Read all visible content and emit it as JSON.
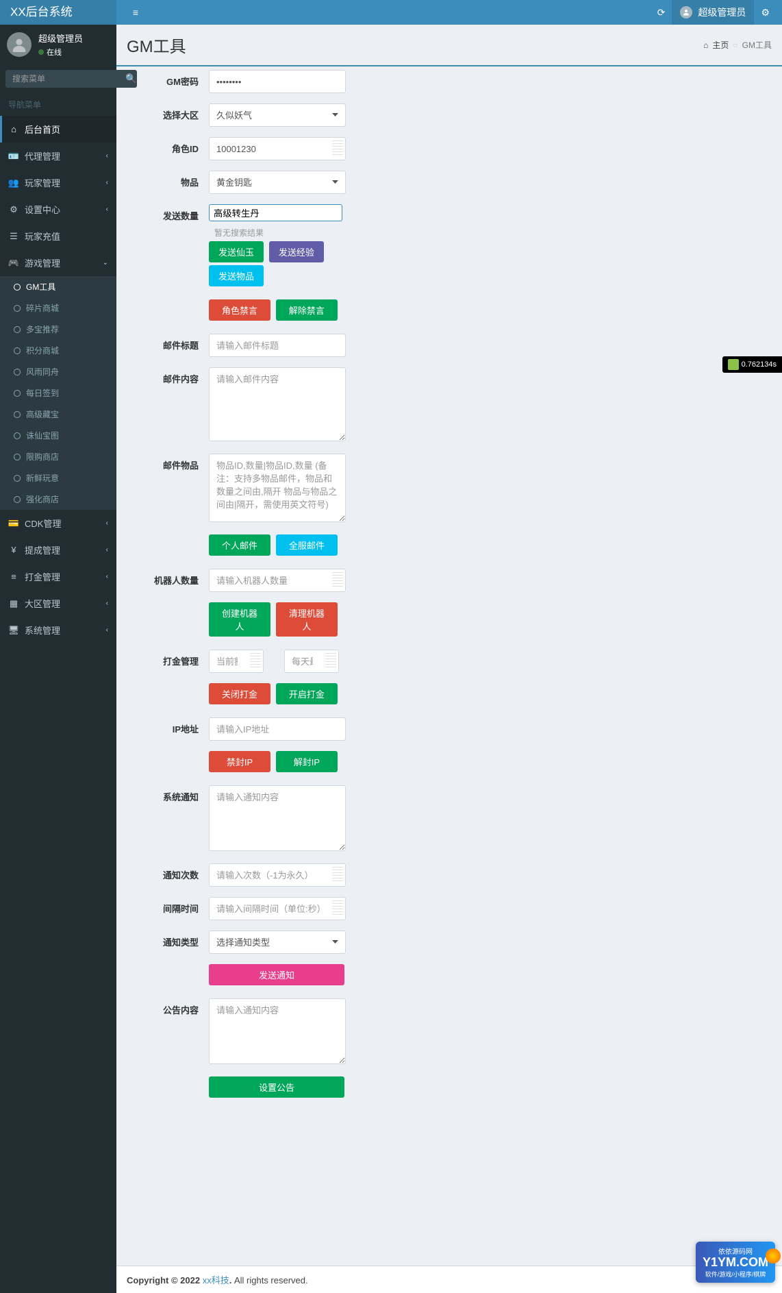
{
  "header": {
    "logo": "XX后台系统",
    "username": "超级管理员"
  },
  "sidebar": {
    "username": "超级管理员",
    "statusText": "在线",
    "searchPlaceholder": "搜索菜单",
    "navHeader": "导航菜单",
    "items": [
      {
        "label": "后台首页",
        "icon": "home",
        "active": true
      },
      {
        "label": "代理管理",
        "icon": "id",
        "expand": true
      },
      {
        "label": "玩家管理",
        "icon": "users",
        "expand": true
      },
      {
        "label": "设置中心",
        "icon": "cogs",
        "expand": true
      },
      {
        "label": "玩家充值",
        "icon": "list"
      },
      {
        "label": "游戏管理",
        "icon": "gamepad",
        "expand": true,
        "open": true,
        "sub": [
          {
            "label": "GM工具",
            "active": true
          },
          {
            "label": "碎片商城"
          },
          {
            "label": "多宝推荐"
          },
          {
            "label": "积分商城"
          },
          {
            "label": "风雨同舟"
          },
          {
            "label": "每日签到"
          },
          {
            "label": "高级藏宝"
          },
          {
            "label": "诛仙宝图"
          },
          {
            "label": "限购商店"
          },
          {
            "label": "新鲜玩意"
          },
          {
            "label": "强化商店"
          }
        ]
      },
      {
        "label": "CDK管理",
        "icon": "card",
        "expand": true
      },
      {
        "label": "提成管理",
        "icon": "yen",
        "expand": true
      },
      {
        "label": "打金管理",
        "icon": "list2",
        "expand": true
      },
      {
        "label": "大区管理",
        "icon": "grid",
        "expand": true
      },
      {
        "label": "系统管理",
        "icon": "desktop",
        "expand": true
      }
    ]
  },
  "page": {
    "title": "GM工具",
    "breadcrumb": {
      "home": "主页",
      "current": "GM工具"
    }
  },
  "form": {
    "gmPasswordLabel": "GM密码",
    "gmPasswordValue": "••••••••",
    "regionLabel": "选择大区",
    "regionValue": "久似妖气",
    "roleIdLabel": "角色ID",
    "roleIdValue": "10001230",
    "itemLabel": "物品",
    "itemValue": "黄金钥匙",
    "qtyLabel": "发送数量",
    "dropdownInput": "高级转生丹",
    "dropdownEmpty": "暂无搜索结果",
    "btnSendXianyu": "发送仙玉",
    "btnSendExp": "发送经验",
    "btnSendItem": "发送物品",
    "btnBanRole": "角色禁言",
    "btnUnban": "解除禁言",
    "mailTitleLabel": "邮件标题",
    "mailTitlePh": "请输入邮件标题",
    "mailContentLabel": "邮件内容",
    "mailContentPh": "请输入邮件内容",
    "mailItemLabel": "邮件物品",
    "mailItemPh": "物品ID,数量|物品ID,数量 (备注：支持多物品邮件，物品和数量之间由,隔开 物品与物品之间由|隔开，需使用英文符号)",
    "btnPersonalMail": "个人邮件",
    "btnServerMail": "全服邮件",
    "robotLabel": "机器人数量",
    "robotPh": "请输入机器人数量",
    "btnCreateRobot": "创建机器人",
    "btnClearRobot": "清理机器人",
    "goldLabel": "打金管理",
    "goldPh1": "当前额度",
    "goldPh2": "每天最大额",
    "btnCloseGold": "关闭打金",
    "btnOpenGold": "开启打金",
    "ipLabel": "IP地址",
    "ipPh": "请输入IP地址",
    "btnBanIp": "禁封IP",
    "btnUnbanIp": "解封IP",
    "noticeLabel": "系统通知",
    "noticePh": "请输入通知内容",
    "noticeCountLabel": "通知次数",
    "noticeCountPh": "请输入次数（-1为永久）",
    "intervalLabel": "间隔时间",
    "intervalPh": "请输入间隔时间（单位:秒）",
    "noticeTypeLabel": "通知类型",
    "noticeTypeValue": "选择通知类型",
    "btnSendNotice": "发送通知",
    "announceLabel": "公告内容",
    "announcePh": "请输入通知内容",
    "btnSetAnnounce": "设置公告"
  },
  "footer": {
    "copyright": "Copyright © 2022 ",
    "company": "xx科技",
    "rights": " All rights reserved."
  },
  "trace": "0.762134s",
  "watermark": {
    "top": "依依源码网",
    "mid": "Y1YM.COM",
    "bottom": "软件/游戏/小程序/棋牌"
  }
}
